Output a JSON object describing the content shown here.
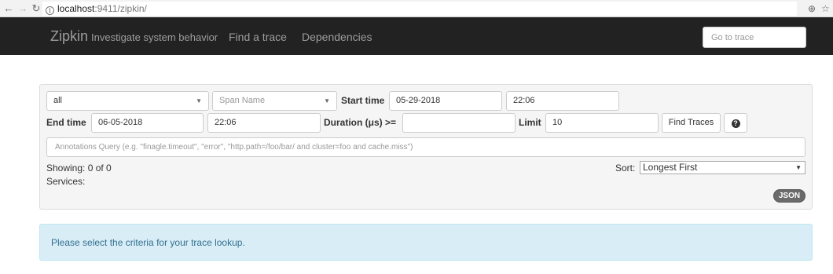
{
  "browser": {
    "url_host": "localhost",
    "url_path": ":9411/zipkin/",
    "back_icon": "arrow-left",
    "forward_icon": "arrow-right",
    "reload_icon": "reload",
    "zoom_icon": "zoom-magnifier",
    "bookmark_icon": "star"
  },
  "navbar": {
    "brand": "Zipkin",
    "tagline": "Investigate system behavior",
    "links": [
      "Find a trace",
      "Dependencies"
    ],
    "goto_placeholder": "Go to trace"
  },
  "search": {
    "service_value": "all",
    "span_name_placeholder": "Span Name",
    "start_time_label": "Start time",
    "start_date": "05-29-2018",
    "start_clock": "22:06",
    "end_time_label": "End time",
    "end_date": "06-05-2018",
    "end_clock": "22:06",
    "duration_label": "Duration (μs) >=",
    "duration_value": "",
    "limit_label": "Limit",
    "limit_value": "10",
    "find_button": "Find Traces",
    "help_icon": "question-circle",
    "annotations_placeholder": "Annotations Query (e.g. \"finagle.timeout\", \"error\", \"http.path=/foo/bar/ and cluster=foo and cache.miss\")"
  },
  "results": {
    "showing": "Showing: 0 of 0",
    "services": "Services:",
    "sort_label": "Sort:",
    "sort_value": "Longest First",
    "json_badge": "JSON"
  },
  "alert": {
    "message": "Please select the criteria for your trace lookup."
  }
}
